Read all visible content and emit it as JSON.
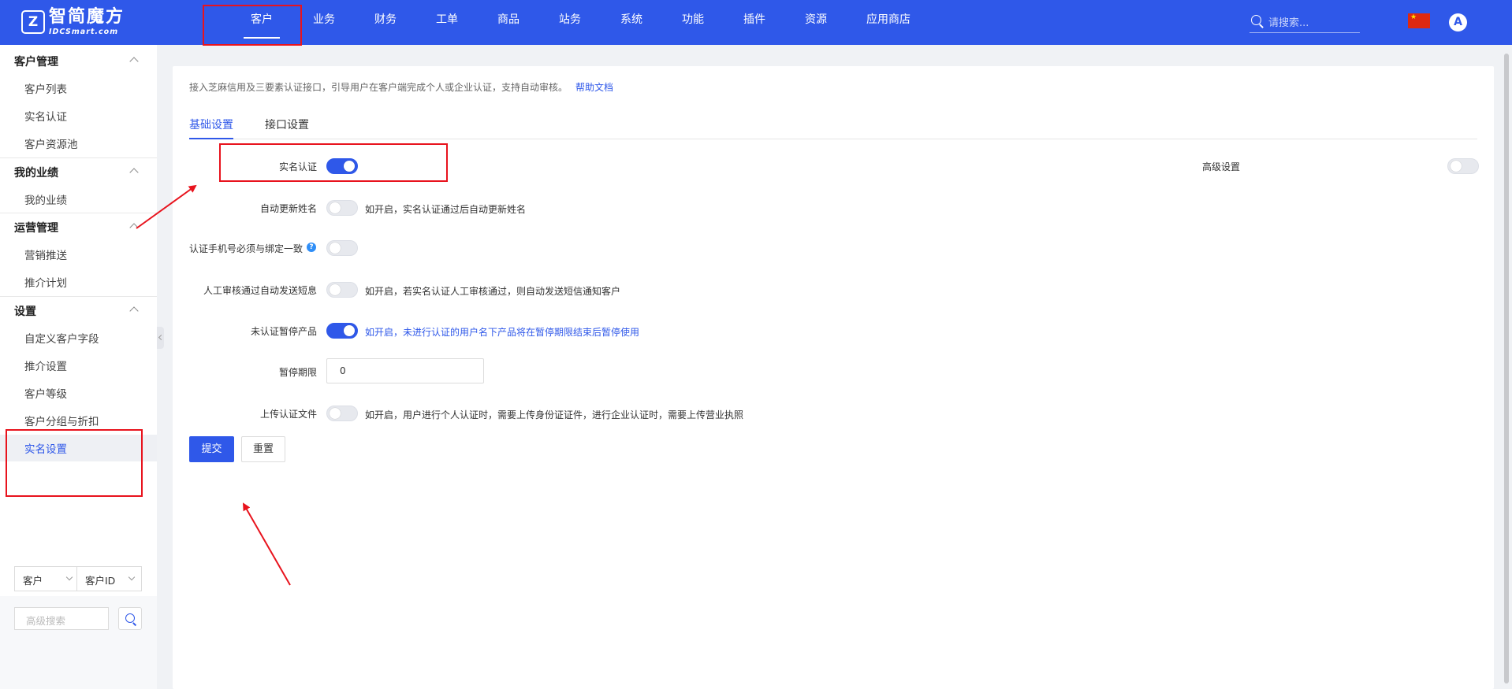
{
  "header": {
    "logo_cn": "智简魔方",
    "logo_en": "IDCSmart.com",
    "nav": [
      "客户",
      "业务",
      "财务",
      "工单",
      "商品",
      "站务",
      "系统",
      "功能",
      "插件",
      "资源",
      "应用商店"
    ],
    "active_nav": "客户",
    "search_placeholder": "请搜索...",
    "avatar_letter": "A"
  },
  "sidebar": {
    "groups": [
      {
        "title": "客户管理",
        "items": [
          "客户列表",
          "实名认证",
          "客户资源池"
        ]
      },
      {
        "title": "我的业绩",
        "items": [
          "我的业绩"
        ]
      },
      {
        "title": "运营管理",
        "items": [
          "营销推送",
          "推介计划"
        ]
      },
      {
        "title": "设置",
        "items": [
          "自定义客户字段",
          "推介设置",
          "客户等级",
          "客户分组与折扣",
          "实名设置"
        ]
      }
    ],
    "active_item": "实名设置",
    "filter_type": "客户",
    "filter_field": "客户ID",
    "advanced_search_placeholder": "高级搜索"
  },
  "main": {
    "intro": "接入芝麻信用及三要素认证接口，引导用户在客户端完成个人或企业认证，支持自动审核。",
    "help_link": "帮助文档",
    "tabs": [
      "基础设置",
      "接口设置"
    ],
    "active_tab": "基础设置",
    "advanced_settings_label": "高级设置",
    "advanced_settings_on": false,
    "settings": [
      {
        "label": "实名认证",
        "on": true,
        "hint": ""
      },
      {
        "label": "自动更新姓名",
        "on": false,
        "hint": "如开启，实名认证通过后自动更新姓名"
      },
      {
        "label": "认证手机号必须与绑定一致",
        "on": false,
        "hint": "",
        "help_icon": "?"
      },
      {
        "label": "人工审核通过自动发送短息",
        "on": false,
        "hint": "如开启，若实名认证人工审核通过，则自动发送短信通知客户"
      },
      {
        "label": "未认证暂停产品",
        "on": true,
        "hint": "如开启，未进行认证的用户名下产品将在暂停期限结束后暂停使用"
      },
      {
        "label": "暂停期限",
        "value": "0"
      },
      {
        "label": "上传认证文件",
        "on": false,
        "hint": "如开启，用户进行个人认证时，需要上传身份证证件，进行企业认证时，需要上传营业执照"
      }
    ],
    "submit_label": "提交",
    "reset_label": "重置"
  },
  "colors": {
    "primary": "#2f58e9",
    "annotation": "#e8131d"
  }
}
